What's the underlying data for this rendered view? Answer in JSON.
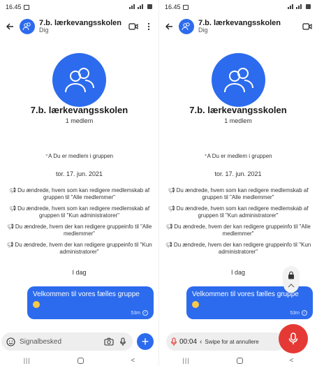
{
  "status_bar": {
    "time": "16.45"
  },
  "header": {
    "title": "7.b. lærkevangsskolen",
    "subtitle": "Dig"
  },
  "group": {
    "name": "7.b. lærkevangsskolen",
    "members": "1 medlem"
  },
  "joined_text": "Du er medlem i gruppen",
  "date_label": "tor. 17. jun. 2021",
  "system_messages": [
    "Du ændrede, hvem som kan redigere medlemskab af gruppen til \"Alle medlemmer\"",
    "Du ændrede, hvem som kan redigere medlemskab af gruppen til \"Kun administratorer\"",
    "Du ændrede, hvem der kan redigere gruppeinfo til \"Alle medlemmer\"",
    "Du ændrede, hvem der kan redigere gruppeinfo til \"Kun administratorer\""
  ],
  "today_label": "I dag",
  "message": {
    "text": "Velkommen til vores fælles gruppe",
    "time": "53m"
  },
  "composer": {
    "placeholder": "Signalbesked"
  },
  "recording": {
    "elapsed": "00:04",
    "hint": "Swipe for at annullere"
  },
  "colors": {
    "accent": "#2c6bed",
    "record": "#e53935"
  }
}
